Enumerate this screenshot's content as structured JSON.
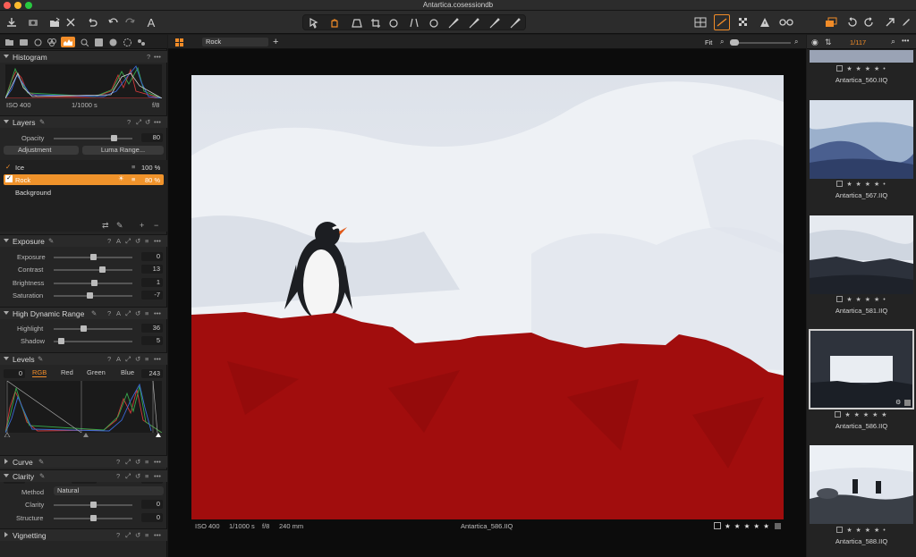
{
  "window": {
    "title": "Antartica.cosessiondb"
  },
  "colors": {
    "accent": "#f28c28",
    "mask": "#a10d0d",
    "selection": "#f0932b"
  },
  "toolbar": {
    "left_icons": [
      "import-icon",
      "camera-icon",
      "export-icon",
      "delete-icon",
      "undo-history-icon",
      "undo-icon",
      "redo-icon",
      "text-icon"
    ],
    "center_icons": [
      "select-icon",
      "pan-icon",
      "perspective-icon",
      "crop-icon",
      "rotate-icon",
      "keystone-icon",
      "spot-icon",
      "brush-icon",
      "erase-icon",
      "gradient-icon",
      "fill-icon"
    ],
    "right_icons": [
      "grid-icon",
      "compare-icon",
      "checker-icon",
      "warning-icon",
      "glasses-icon",
      "stack-icon",
      "rotate-left-icon",
      "rotate-right-icon",
      "cursor-icon",
      "pen-icon"
    ]
  },
  "left": {
    "histogram": {
      "title": "Histogram",
      "iso": "ISO 400",
      "shutter": "1/1000 s",
      "aperture": "f/8"
    },
    "layers": {
      "title": "Layers",
      "opacity_label": "Opacity",
      "opacity_value": "80",
      "adjustment_btn": "Adjustment",
      "luma_btn": "Luma Range...",
      "items": [
        {
          "name": "Ice",
          "value": "100 %"
        },
        {
          "name": "Rock",
          "value": "80 %"
        },
        {
          "name": "Background",
          "value": ""
        }
      ]
    },
    "exposure": {
      "title": "Exposure",
      "rows": [
        {
          "label": "Exposure",
          "value": "0"
        },
        {
          "label": "Contrast",
          "value": "13"
        },
        {
          "label": "Brightness",
          "value": "1"
        },
        {
          "label": "Saturation",
          "value": "-7"
        }
      ]
    },
    "hdr": {
      "title": "High Dynamic Range",
      "rows": [
        {
          "label": "Highlight",
          "value": "36"
        },
        {
          "label": "Shadow",
          "value": "5"
        }
      ]
    },
    "levels": {
      "title": "Levels",
      "left_value": "0",
      "channels": [
        "RGB",
        "Red",
        "Green",
        "Blue"
      ],
      "right_value": "243",
      "low": "0",
      "mid": "-0,03",
      "high": "255"
    },
    "curve": {
      "title": "Curve"
    },
    "clarity": {
      "title": "Clarity",
      "method_label": "Method",
      "method_value": "Natural",
      "rows": [
        {
          "label": "Clarity",
          "value": "0"
        },
        {
          "label": "Structure",
          "value": "0"
        }
      ]
    },
    "vignetting": {
      "title": "Vignetting"
    }
  },
  "viewer": {
    "layer_select": "Rock",
    "zoom": "Fit",
    "iso": "ISO 400",
    "shutter": "1/1000 s",
    "aperture": "f/8",
    "focal": "240 mm",
    "filename": "Antartica_586.IIQ",
    "stars": "★ ★ ★ ★ ★"
  },
  "browser": {
    "count": "1/117",
    "items": [
      {
        "name": "Antartica_560.IIQ",
        "stars": "★ ★ ★ ★ •"
      },
      {
        "name": "Antartica_567.IIQ",
        "stars": "★ ★ ★ ★ •"
      },
      {
        "name": "Antartica_581.IIQ",
        "stars": "★ ★ ★ ★ •"
      },
      {
        "name": "Antartica_586.IIQ",
        "stars": "★ ★ ★ ★ ★"
      },
      {
        "name": "Antartica_588.IIQ",
        "stars": "★ ★ ★ ★ •"
      }
    ]
  }
}
